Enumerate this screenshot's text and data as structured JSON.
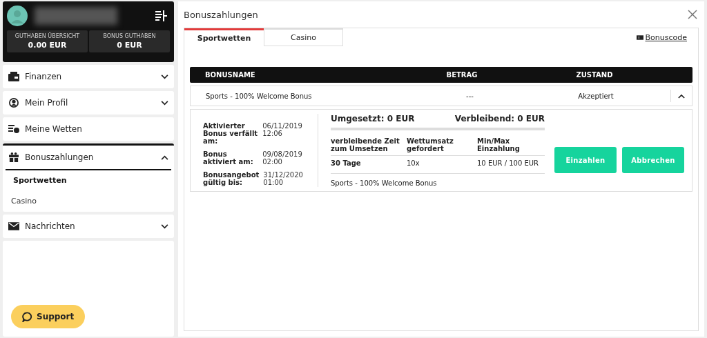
{
  "account": {
    "balances": [
      {
        "label": "GUTHABEN ÜBERSICHT",
        "value": "0.00 EUR"
      },
      {
        "label": "BONUS GUTHABEN",
        "value": "0 EUR"
      }
    ]
  },
  "menu": [
    {
      "label": "Finanzen",
      "kind": "group",
      "expanded": false
    },
    {
      "label": "Mein Profil",
      "kind": "group",
      "expanded": false
    },
    {
      "label": "Meine Wetten",
      "kind": "link"
    },
    {
      "label": "Bonuszahlungen",
      "kind": "group",
      "expanded": true,
      "children": [
        {
          "label": "Sportwetten",
          "selected": true
        },
        {
          "label": "Casino",
          "selected": false
        }
      ]
    },
    {
      "label": "Nachrichten",
      "kind": "group",
      "expanded": false
    }
  ],
  "support_button": "Support",
  "panel": {
    "title": "Bonuszahlungen",
    "tabs": [
      {
        "label": "Sportwetten",
        "selected": true
      },
      {
        "label": "Casino",
        "selected": false
      }
    ],
    "bonuscode_link": "Bonuscode",
    "table": {
      "columns": [
        "BONUSNAME",
        "BETRAG",
        "ZUSTAND"
      ],
      "rows": [
        {
          "cells": [
            "Sports - 100% Welcome Bonus",
            "---",
            "Akzeptiert"
          ],
          "expanded": true
        }
      ]
    },
    "details": {
      "dates": [
        {
          "label": "Aktivierter Bonus verfällt am:",
          "value": "06/11/2019 12:06"
        },
        {
          "label": "Bonus aktiviert am:",
          "value": "09/08/2019 02:00"
        },
        {
          "label": "Bonusangebot gültig bis:",
          "value": "31/12/2020 01:00"
        }
      ],
      "wagered": "Umgesetzt: 0 EUR",
      "remaining": "Verbleibend: 0 EUR",
      "level": 0,
      "columns": [
        "verbleibende Zeit zum Umsetzen",
        "Wettumsatz gefordert",
        "Min/Max Einzahlung"
      ],
      "values": [
        "30 Tage",
        "10x",
        "10 EUR / 100 EUR"
      ],
      "bonus_name": "Sports - 100% Welcome Bonus",
      "buttons": [
        "Einzahlen",
        "Abbrechen"
      ]
    }
  }
}
